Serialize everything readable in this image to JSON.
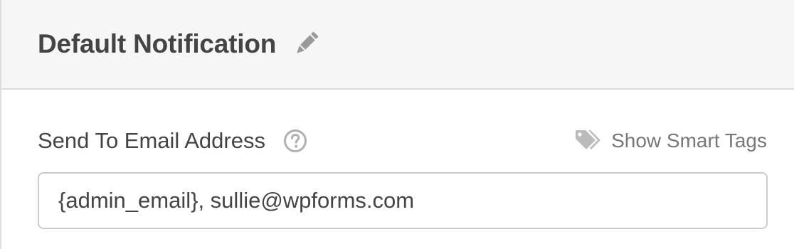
{
  "header": {
    "title": "Default Notification",
    "edit_icon": "pencil-icon"
  },
  "send_to": {
    "label": "Send To Email Address",
    "help_icon": "question-circle-icon",
    "smart_tags_icon": "tags-icon",
    "smart_tags_label": "Show Smart Tags",
    "value": "{admin_email}, sullie@wpforms.com"
  },
  "colors": {
    "header_bg": "#f6f6f6",
    "text": "#444444",
    "muted": "#777777",
    "icon": "#999999",
    "border": "#dddddd"
  }
}
